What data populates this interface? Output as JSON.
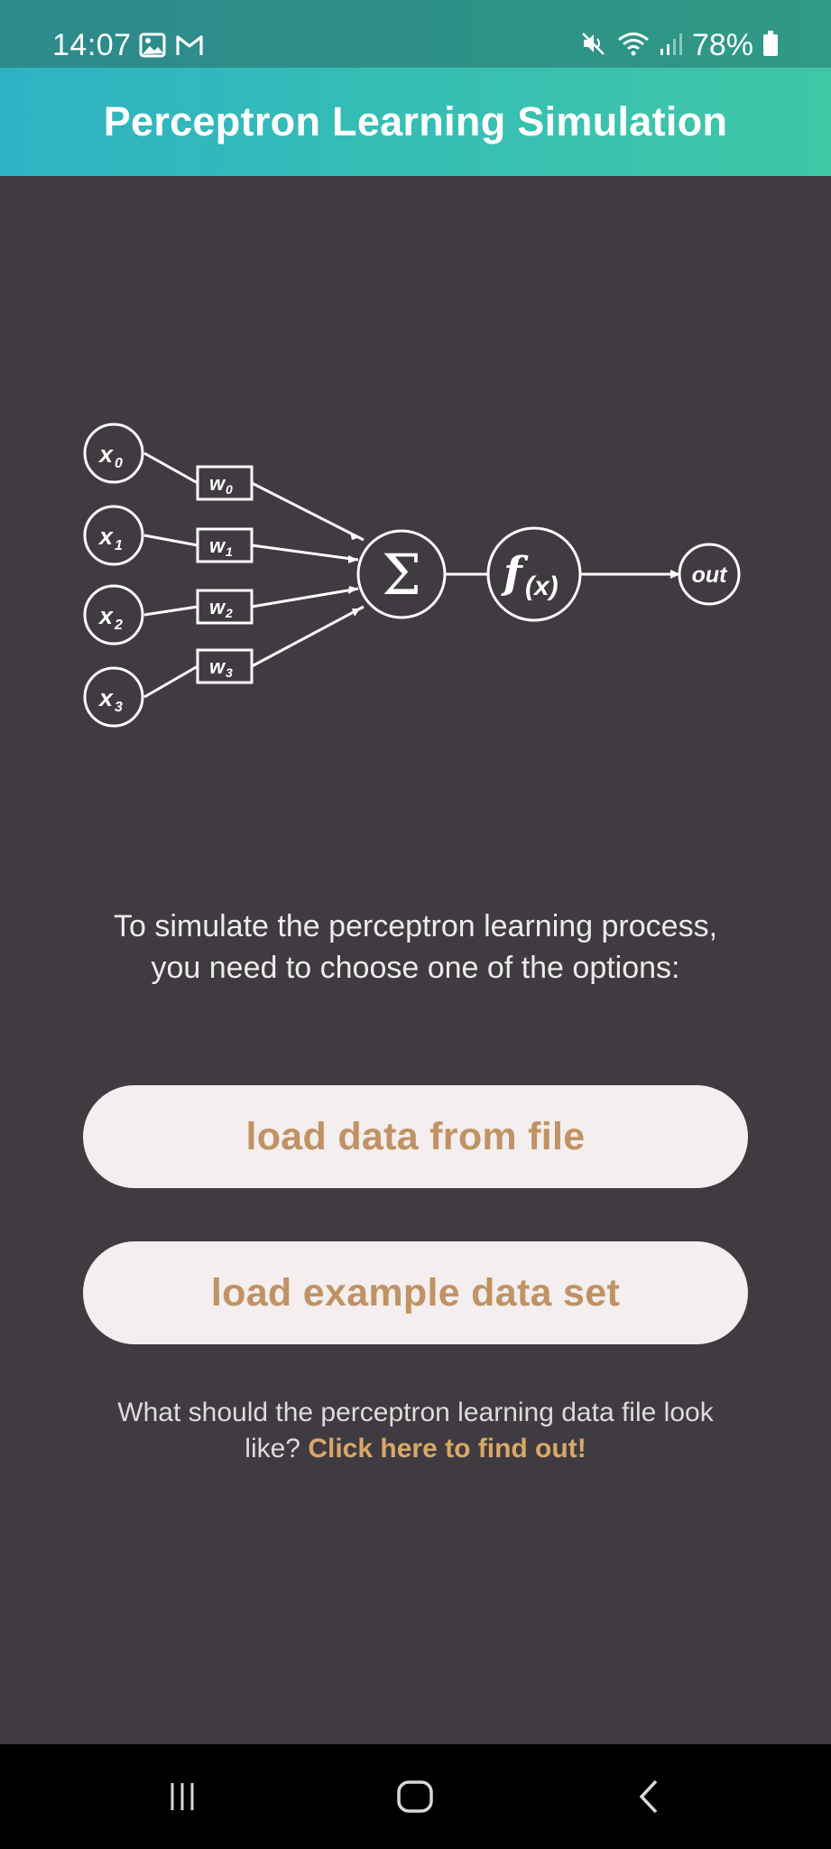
{
  "status_bar": {
    "time": "14:07",
    "battery": "78%",
    "icons": [
      "gallery-icon",
      "gmail-icon",
      "mute-icon",
      "wifi-icon",
      "signal-icon",
      "battery-icon"
    ]
  },
  "header": {
    "title": "Perceptron Learning Simulation"
  },
  "diagram": {
    "inputs": [
      "x",
      "x",
      "x",
      "x"
    ],
    "input_subscripts": [
      "0",
      "1",
      "2",
      "3"
    ],
    "weights": [
      "w",
      "w",
      "w",
      "w"
    ],
    "weight_subscripts": [
      "0",
      "1",
      "2",
      "3"
    ],
    "sum_symbol": "Σ",
    "activation_main": "f",
    "activation_arg": "(x)",
    "output": "out"
  },
  "main": {
    "instructions": "To simulate the perceptron learning process, you need to choose one of the options:",
    "load_file_label": "load data from file",
    "load_example_label": "load example data set",
    "help_text": "What should the perceptron learning data file look like? ",
    "help_link": "Click here to find out!"
  },
  "colors": {
    "background": "#403b40",
    "header_gradient_start": "#2fb2c4",
    "header_gradient_end": "#40c7a6",
    "button_bg": "#f4eeee",
    "button_text": "#c09264",
    "link_text": "#d8a86a"
  },
  "nav_bar": {
    "icons": [
      "recents-icon",
      "home-icon",
      "back-icon"
    ]
  }
}
